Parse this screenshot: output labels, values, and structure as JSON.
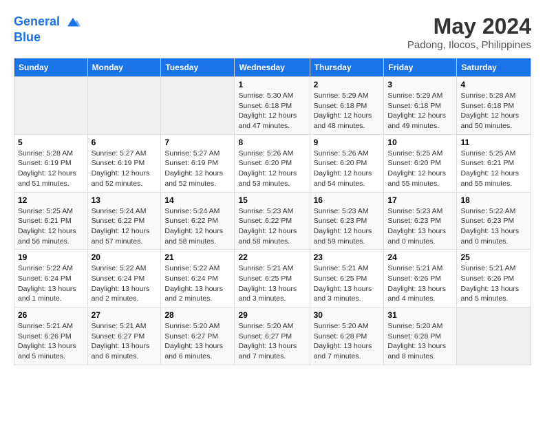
{
  "header": {
    "logo_line1": "General",
    "logo_line2": "Blue",
    "month_year": "May 2024",
    "location": "Padong, Ilocos, Philippines"
  },
  "weekdays": [
    "Sunday",
    "Monday",
    "Tuesday",
    "Wednesday",
    "Thursday",
    "Friday",
    "Saturday"
  ],
  "weeks": [
    [
      {
        "day": "",
        "info": ""
      },
      {
        "day": "",
        "info": ""
      },
      {
        "day": "",
        "info": ""
      },
      {
        "day": "1",
        "info": "Sunrise: 5:30 AM\nSunset: 6:18 PM\nDaylight: 12 hours\nand 47 minutes."
      },
      {
        "day": "2",
        "info": "Sunrise: 5:29 AM\nSunset: 6:18 PM\nDaylight: 12 hours\nand 48 minutes."
      },
      {
        "day": "3",
        "info": "Sunrise: 5:29 AM\nSunset: 6:18 PM\nDaylight: 12 hours\nand 49 minutes."
      },
      {
        "day": "4",
        "info": "Sunrise: 5:28 AM\nSunset: 6:18 PM\nDaylight: 12 hours\nand 50 minutes."
      }
    ],
    [
      {
        "day": "5",
        "info": "Sunrise: 5:28 AM\nSunset: 6:19 PM\nDaylight: 12 hours\nand 51 minutes."
      },
      {
        "day": "6",
        "info": "Sunrise: 5:27 AM\nSunset: 6:19 PM\nDaylight: 12 hours\nand 52 minutes."
      },
      {
        "day": "7",
        "info": "Sunrise: 5:27 AM\nSunset: 6:19 PM\nDaylight: 12 hours\nand 52 minutes."
      },
      {
        "day": "8",
        "info": "Sunrise: 5:26 AM\nSunset: 6:20 PM\nDaylight: 12 hours\nand 53 minutes."
      },
      {
        "day": "9",
        "info": "Sunrise: 5:26 AM\nSunset: 6:20 PM\nDaylight: 12 hours\nand 54 minutes."
      },
      {
        "day": "10",
        "info": "Sunrise: 5:25 AM\nSunset: 6:20 PM\nDaylight: 12 hours\nand 55 minutes."
      },
      {
        "day": "11",
        "info": "Sunrise: 5:25 AM\nSunset: 6:21 PM\nDaylight: 12 hours\nand 55 minutes."
      }
    ],
    [
      {
        "day": "12",
        "info": "Sunrise: 5:25 AM\nSunset: 6:21 PM\nDaylight: 12 hours\nand 56 minutes."
      },
      {
        "day": "13",
        "info": "Sunrise: 5:24 AM\nSunset: 6:22 PM\nDaylight: 12 hours\nand 57 minutes."
      },
      {
        "day": "14",
        "info": "Sunrise: 5:24 AM\nSunset: 6:22 PM\nDaylight: 12 hours\nand 58 minutes."
      },
      {
        "day": "15",
        "info": "Sunrise: 5:23 AM\nSunset: 6:22 PM\nDaylight: 12 hours\nand 58 minutes."
      },
      {
        "day": "16",
        "info": "Sunrise: 5:23 AM\nSunset: 6:23 PM\nDaylight: 12 hours\nand 59 minutes."
      },
      {
        "day": "17",
        "info": "Sunrise: 5:23 AM\nSunset: 6:23 PM\nDaylight: 13 hours\nand 0 minutes."
      },
      {
        "day": "18",
        "info": "Sunrise: 5:22 AM\nSunset: 6:23 PM\nDaylight: 13 hours\nand 0 minutes."
      }
    ],
    [
      {
        "day": "19",
        "info": "Sunrise: 5:22 AM\nSunset: 6:24 PM\nDaylight: 13 hours\nand 1 minute."
      },
      {
        "day": "20",
        "info": "Sunrise: 5:22 AM\nSunset: 6:24 PM\nDaylight: 13 hours\nand 2 minutes."
      },
      {
        "day": "21",
        "info": "Sunrise: 5:22 AM\nSunset: 6:24 PM\nDaylight: 13 hours\nand 2 minutes."
      },
      {
        "day": "22",
        "info": "Sunrise: 5:21 AM\nSunset: 6:25 PM\nDaylight: 13 hours\nand 3 minutes."
      },
      {
        "day": "23",
        "info": "Sunrise: 5:21 AM\nSunset: 6:25 PM\nDaylight: 13 hours\nand 3 minutes."
      },
      {
        "day": "24",
        "info": "Sunrise: 5:21 AM\nSunset: 6:26 PM\nDaylight: 13 hours\nand 4 minutes."
      },
      {
        "day": "25",
        "info": "Sunrise: 5:21 AM\nSunset: 6:26 PM\nDaylight: 13 hours\nand 5 minutes."
      }
    ],
    [
      {
        "day": "26",
        "info": "Sunrise: 5:21 AM\nSunset: 6:26 PM\nDaylight: 13 hours\nand 5 minutes."
      },
      {
        "day": "27",
        "info": "Sunrise: 5:21 AM\nSunset: 6:27 PM\nDaylight: 13 hours\nand 6 minutes."
      },
      {
        "day": "28",
        "info": "Sunrise: 5:20 AM\nSunset: 6:27 PM\nDaylight: 13 hours\nand 6 minutes."
      },
      {
        "day": "29",
        "info": "Sunrise: 5:20 AM\nSunset: 6:27 PM\nDaylight: 13 hours\nand 7 minutes."
      },
      {
        "day": "30",
        "info": "Sunrise: 5:20 AM\nSunset: 6:28 PM\nDaylight: 13 hours\nand 7 minutes."
      },
      {
        "day": "31",
        "info": "Sunrise: 5:20 AM\nSunset: 6:28 PM\nDaylight: 13 hours\nand 8 minutes."
      },
      {
        "day": "",
        "info": ""
      }
    ]
  ]
}
